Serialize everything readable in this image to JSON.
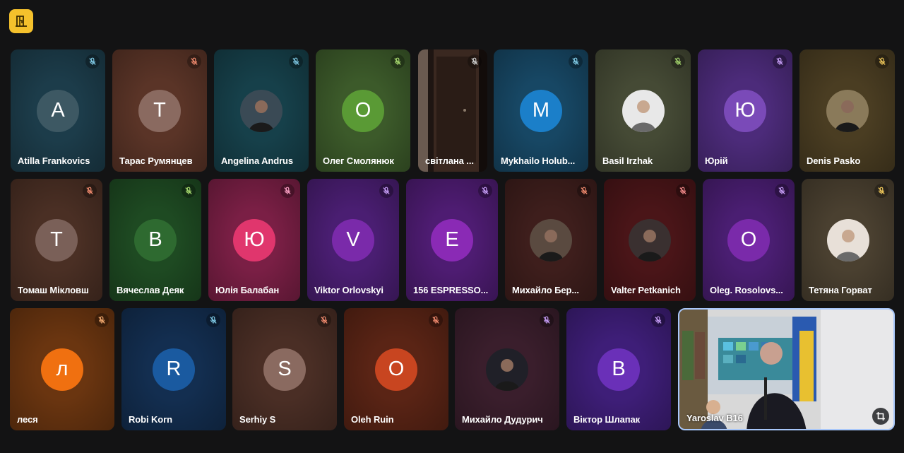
{
  "app": {
    "logo_icon": "door-icon",
    "logo_color": "#f5c12c"
  },
  "participants": [
    {
      "name": "Atilla Frankovics",
      "initial": "A",
      "bg": "#1c3c4a",
      "avatar_bg": "#3d5863",
      "mic_color": "#7ec8e3",
      "avatar_type": "letter"
    },
    {
      "name": "Тарас Румянцев",
      "initial": "Т",
      "bg": "#5a3427",
      "avatar_bg": "#8a6a60",
      "mic_color": "#f08a6e",
      "avatar_type": "letter"
    },
    {
      "name": "Angelina Andrus",
      "initial": "",
      "bg": "#16404a",
      "avatar_bg": "#3a4a55",
      "mic_color": "#7ec8e3",
      "avatar_type": "photo"
    },
    {
      "name": "Олег Смолянюк",
      "initial": "О",
      "bg": "#3c5a2a",
      "avatar_bg": "#5a9a35",
      "mic_color": "#a6d86e",
      "avatar_type": "letter"
    },
    {
      "name": "світлана ...",
      "initial": "",
      "bg": "#2a1e19",
      "avatar_bg": "",
      "mic_color": "#cccccc",
      "avatar_type": "video-door"
    },
    {
      "name": "Mykhailo Holub...",
      "initial": "M",
      "bg": "#174764",
      "avatar_bg": "#1b7fc9",
      "mic_color": "#7ec8e3",
      "avatar_type": "letter"
    },
    {
      "name": "Basil Irzhak",
      "initial": "",
      "bg": "#454a35",
      "avatar_bg": "#e8e8e8",
      "mic_color": "#a6d86e",
      "avatar_type": "photo-white"
    },
    {
      "name": "Юрій",
      "initial": "Ю",
      "bg": "#4c2b7a",
      "avatar_bg": "#7a4ab8",
      "mic_color": "#c59cf5",
      "avatar_type": "letter"
    },
    {
      "name": "Denis Pasko",
      "initial": "",
      "bg": "#4a3d22",
      "avatar_bg": "#8a7a5a",
      "mic_color": "#f0c85a",
      "avatar_type": "photo"
    },
    {
      "name": "Томаш Мікловш",
      "initial": "Т",
      "bg": "#4a2f24",
      "avatar_bg": "#7a6058",
      "mic_color": "#f08a6e",
      "avatar_type": "letter"
    },
    {
      "name": "Вячеслав Деяк",
      "initial": "В",
      "bg": "#1e4a22",
      "avatar_bg": "#2e6a30",
      "mic_color": "#a6d86e",
      "avatar_type": "letter"
    },
    {
      "name": "Юлія Балабан",
      "initial": "Ю",
      "bg": "#7a1f45",
      "avatar_bg": "#e0366d",
      "mic_color": "#f59cc0",
      "avatar_type": "letter"
    },
    {
      "name": "Viktor Orlovskyi",
      "initial": "V",
      "bg": "#4a1e72",
      "avatar_bg": "#7a2aaa",
      "mic_color": "#c59cf5",
      "avatar_type": "letter"
    },
    {
      "name": "156 ESPRESSO...",
      "initial": "E",
      "bg": "#4e1c72",
      "avatar_bg": "#8a2ab5",
      "mic_color": "#c59cf5",
      "avatar_type": "letter"
    },
    {
      "name": "Михайло Бер...",
      "initial": "",
      "bg": "#3e1e1c",
      "avatar_bg": "#5a4a40",
      "mic_color": "#f08a6e",
      "avatar_type": "photo"
    },
    {
      "name": "Valter Petkanich",
      "initial": "",
      "bg": "#4a1518",
      "avatar_bg": "#3a3030",
      "mic_color": "#f08a8a",
      "avatar_type": "photo"
    },
    {
      "name": "Oleg. Rosolovs...",
      "initial": "O",
      "bg": "#4a1e72",
      "avatar_bg": "#7a2aaa",
      "mic_color": "#c59cf5",
      "avatar_type": "letter"
    },
    {
      "name": "Тетяна Горват",
      "initial": "",
      "bg": "#4a4030",
      "avatar_bg": "#e8e0d8",
      "mic_color": "#f0c85a",
      "avatar_type": "photo-white"
    },
    {
      "name": "леся",
      "initial": "л",
      "bg": "#6a3510",
      "avatar_bg": "#f07010",
      "mic_color": "#f0a86e",
      "avatar_type": "letter"
    },
    {
      "name": "Robi Korn",
      "initial": "R",
      "bg": "#132e50",
      "avatar_bg": "#1a5aa0",
      "mic_color": "#7ec8e3",
      "avatar_type": "letter"
    },
    {
      "name": "Serhiy S",
      "initial": "S",
      "bg": "#4a2e25",
      "avatar_bg": "#8a6a60",
      "mic_color": "#f08a6e",
      "avatar_type": "letter"
    },
    {
      "name": "Oleh Ruin",
      "initial": "O",
      "bg": "#5a2415",
      "avatar_bg": "#c84520",
      "mic_color": "#f08a6e",
      "avatar_type": "letter"
    },
    {
      "name": "Михайло Дудурич",
      "initial": "",
      "bg": "#3a1e2c",
      "avatar_bg": "#202028",
      "mic_color": "#c59cf5",
      "avatar_type": "photo"
    },
    {
      "name": "Віктор Шлапак",
      "initial": "В",
      "bg": "#3e1e78",
      "avatar_bg": "#6a30b8",
      "mic_color": "#c59cf5",
      "avatar_type": "letter"
    },
    {
      "name": "Yaroslav B16",
      "initial": "",
      "bg": "#c8c8c8",
      "avatar_bg": "",
      "mic_color": "",
      "avatar_type": "video-speaker"
    }
  ],
  "icons": {
    "mic_muted": "mic-off-icon",
    "pin": "crop-icon"
  }
}
